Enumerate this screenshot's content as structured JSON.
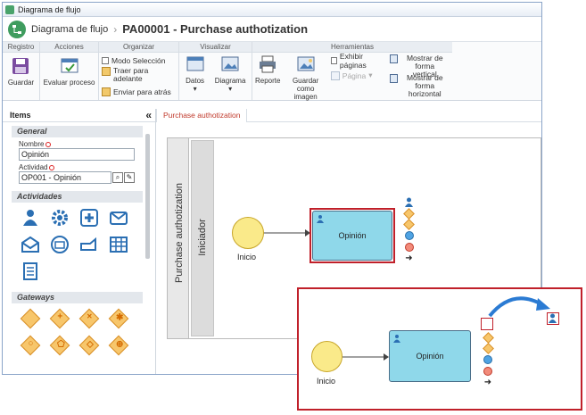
{
  "window": {
    "title": "Diagrama de flujo"
  },
  "header": {
    "crumb_app": "Diagrama de flujo",
    "crumb_doc": "PA00001 - Purchase authotization"
  },
  "ribbon": {
    "groups": {
      "registro": "Registro",
      "acciones": "Acciones",
      "organizar": "Organizar",
      "visualizar": "Visualizar",
      "herramientas": "Herramientas"
    },
    "buttons": {
      "guardar": "Guardar",
      "evaluar": "Evaluar proceso",
      "modo_seleccion": "Modo Selección",
      "traer_1": "Traer para",
      "traer_2": "adelante",
      "enviar": "Enviar para atrás",
      "datos": "Datos",
      "diagrama": "Diagrama",
      "reporte": "Reporte",
      "guardar_imagen_1": "Guardar como",
      "guardar_imagen_2": "imagen",
      "exhibir_paginas": "Exhibir páginas",
      "pagina": "Página",
      "vertical_1": "Mostrar de forma",
      "vertical_2": "vertical",
      "horizontal_1": "Mostrar de forma",
      "horizontal_2": "horizontal"
    }
  },
  "left": {
    "title": "Items",
    "collapse": "«",
    "general": "General",
    "nombre_label": "Nombre",
    "nombre_value": "Opinión",
    "actividad_label": "Actividad",
    "actividad_value": "OP001 - Opinión",
    "actividades": "Actividades",
    "gateways": "Gateways"
  },
  "canvas": {
    "tab": "Purchase authotization",
    "pool_label": "Purchase authotization",
    "lane_label": "Iniciador",
    "start_label": "Inicio",
    "task_label": "Opinión"
  },
  "zoom": {
    "start_label": "Inicio",
    "task_label": "Opinión"
  },
  "colors": {
    "accent_red": "#c0202a",
    "task_fill": "#8fd8ea",
    "start_fill": "#faea8a"
  }
}
